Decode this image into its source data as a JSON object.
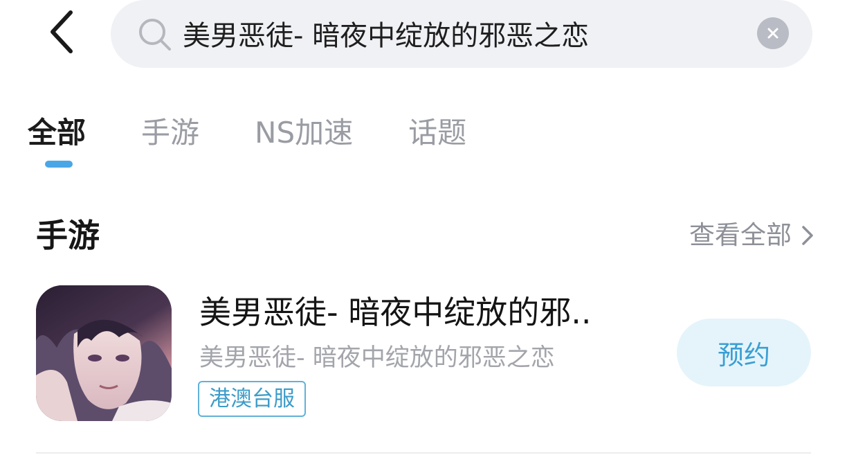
{
  "search": {
    "value": "美男恶徒- 暗夜中绽放的邪恶之恋",
    "placeholder": ""
  },
  "tabs": [
    {
      "label": "全部",
      "active": true
    },
    {
      "label": "手游",
      "active": false
    },
    {
      "label": "NS加速",
      "active": false
    },
    {
      "label": "话题",
      "active": false
    }
  ],
  "section": {
    "title": "手游",
    "view_all": "查看全部"
  },
  "game": {
    "name": "美男恶徒- 暗夜中绽放的邪..",
    "subtitle": "美男恶徒- 暗夜中绽放的邪恶之恋",
    "badge": "港澳台服",
    "action": "预约"
  },
  "icons": {
    "back": "chevron-left-icon",
    "search": "search-icon",
    "clear": "clear-icon",
    "view_all": "chevron-right-icon"
  },
  "colors": {
    "accent": "#4aa7e6",
    "search_bg": "#f0f1f5",
    "button_bg": "#e5f4fb",
    "button_text": "#3a9fd3",
    "badge_border": "#5fb2d8"
  }
}
